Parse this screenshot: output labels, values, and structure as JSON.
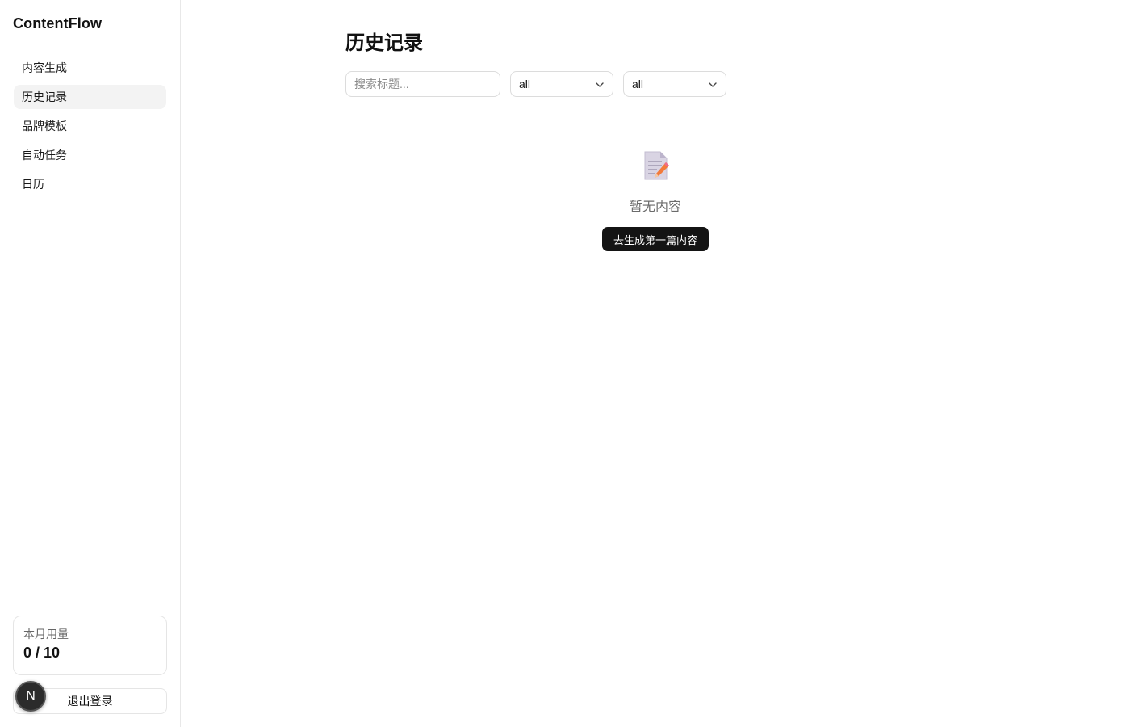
{
  "app": {
    "brand": "ContentFlow"
  },
  "sidebar": {
    "items": [
      {
        "label": "内容生成",
        "active": false
      },
      {
        "label": "历史记录",
        "active": true
      },
      {
        "label": "品牌模板",
        "active": false
      },
      {
        "label": "自动任务",
        "active": false
      },
      {
        "label": "日历",
        "active": false
      }
    ],
    "usage": {
      "label": "本月用量",
      "value": "0 / 10"
    },
    "logout_label": "退出登录",
    "avatar_letter": "N"
  },
  "main": {
    "title": "历史记录",
    "search": {
      "placeholder": "搜索标题...",
      "value": ""
    },
    "filter_1": {
      "selected": "all"
    },
    "filter_2": {
      "selected": "all"
    },
    "empty_state": {
      "icon": "memo-icon",
      "message": "暂无内容",
      "cta_label": "去生成第一篇内容"
    }
  },
  "colors": {
    "active_nav_bg": "#f3f3f3",
    "cta_bg": "#141414",
    "border": "#e5e5e5",
    "muted_text": "#6b6b6b"
  }
}
